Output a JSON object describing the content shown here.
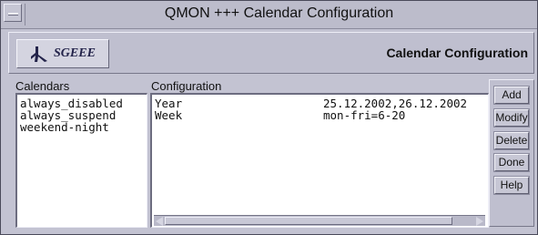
{
  "window": {
    "title": "QMON +++ Calendar Configuration"
  },
  "header": {
    "logo_text": "SGEEE",
    "logo_icon": "sgeee-logo-icon",
    "title": "Calendar Configuration"
  },
  "calendars": {
    "label": "Calendars",
    "items": [
      "always_disabled",
      "always_suspend",
      "weekend-night"
    ]
  },
  "configuration": {
    "label": "Configuration",
    "rows": [
      {
        "key": "Year",
        "value": "25.12.2002,26.12.2002"
      },
      {
        "key": "Week",
        "value": "mon-fri=6-20"
      }
    ]
  },
  "buttons": {
    "add": "Add",
    "modify": "Modify",
    "delete": "Delete",
    "done": "Done",
    "help": "Help"
  },
  "colors": {
    "background": "#c3c3d2",
    "list_background": "#ffffff"
  }
}
